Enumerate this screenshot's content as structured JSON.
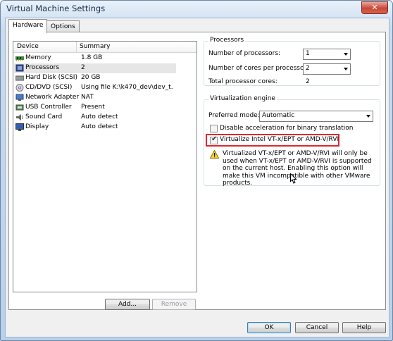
{
  "window": {
    "title": "Virtual Machine Settings",
    "close_glyph": "✕"
  },
  "tabs": [
    {
      "label": "Hardware",
      "active": true
    },
    {
      "label": "Options",
      "active": false
    }
  ],
  "device_list": {
    "columns": [
      "Device",
      "Summary"
    ],
    "rows": [
      {
        "device": "Memory",
        "summary": "1.8 GB",
        "icon": "memory-icon"
      },
      {
        "device": "Processors",
        "summary": "2",
        "icon": "processor-icon",
        "selected": true
      },
      {
        "device": "Hard Disk (SCSI)",
        "summary": "20 GB",
        "icon": "hard-disk-icon"
      },
      {
        "device": "CD/DVD (SCSI)",
        "summary": "Using file K:\\k470_dev\\dev_t...",
        "icon": "cd-dvd-icon"
      },
      {
        "device": "Network Adapter",
        "summary": "NAT",
        "icon": "network-adapter-icon"
      },
      {
        "device": "USB Controller",
        "summary": "Present",
        "icon": "usb-controller-icon"
      },
      {
        "device": "Sound Card",
        "summary": "Auto detect",
        "icon": "sound-card-icon"
      },
      {
        "device": "Display",
        "summary": "Auto detect",
        "icon": "display-icon"
      }
    ],
    "add_label": "Add...",
    "remove_label": "Remove"
  },
  "processors": {
    "group_title": "Processors",
    "num_processors_label": "Number of processors:",
    "num_processors_value": "1",
    "cores_label": "Number of cores per processor:",
    "cores_value": "2",
    "total_label": "Total processor cores:",
    "total_value": "2"
  },
  "virtualization": {
    "group_title": "Virtualization engine",
    "mode_label": "Preferred mode:",
    "mode_value": "Automatic",
    "disable_accel_label": "Disable acceleration for binary translation",
    "disable_accel_checked": false,
    "vtx_label": "Virtualize Intel VT-x/EPT or AMD-V/RVI",
    "vtx_checked": true,
    "warning_text": "Virtualized VT-x/EPT or AMD-V/RVI will only be used when VT-x/EPT or AMD-V/RVI is supported on the current host. Enabling this option will make this VM incompatible with other VMware products.",
    "highlight_color": "#e0252f"
  },
  "footer": {
    "ok_label": "OK",
    "cancel_label": "Cancel",
    "help_label": "Help"
  },
  "colors": {
    "selection": "#e6e6e6",
    "accent": "#3c7fb1"
  }
}
